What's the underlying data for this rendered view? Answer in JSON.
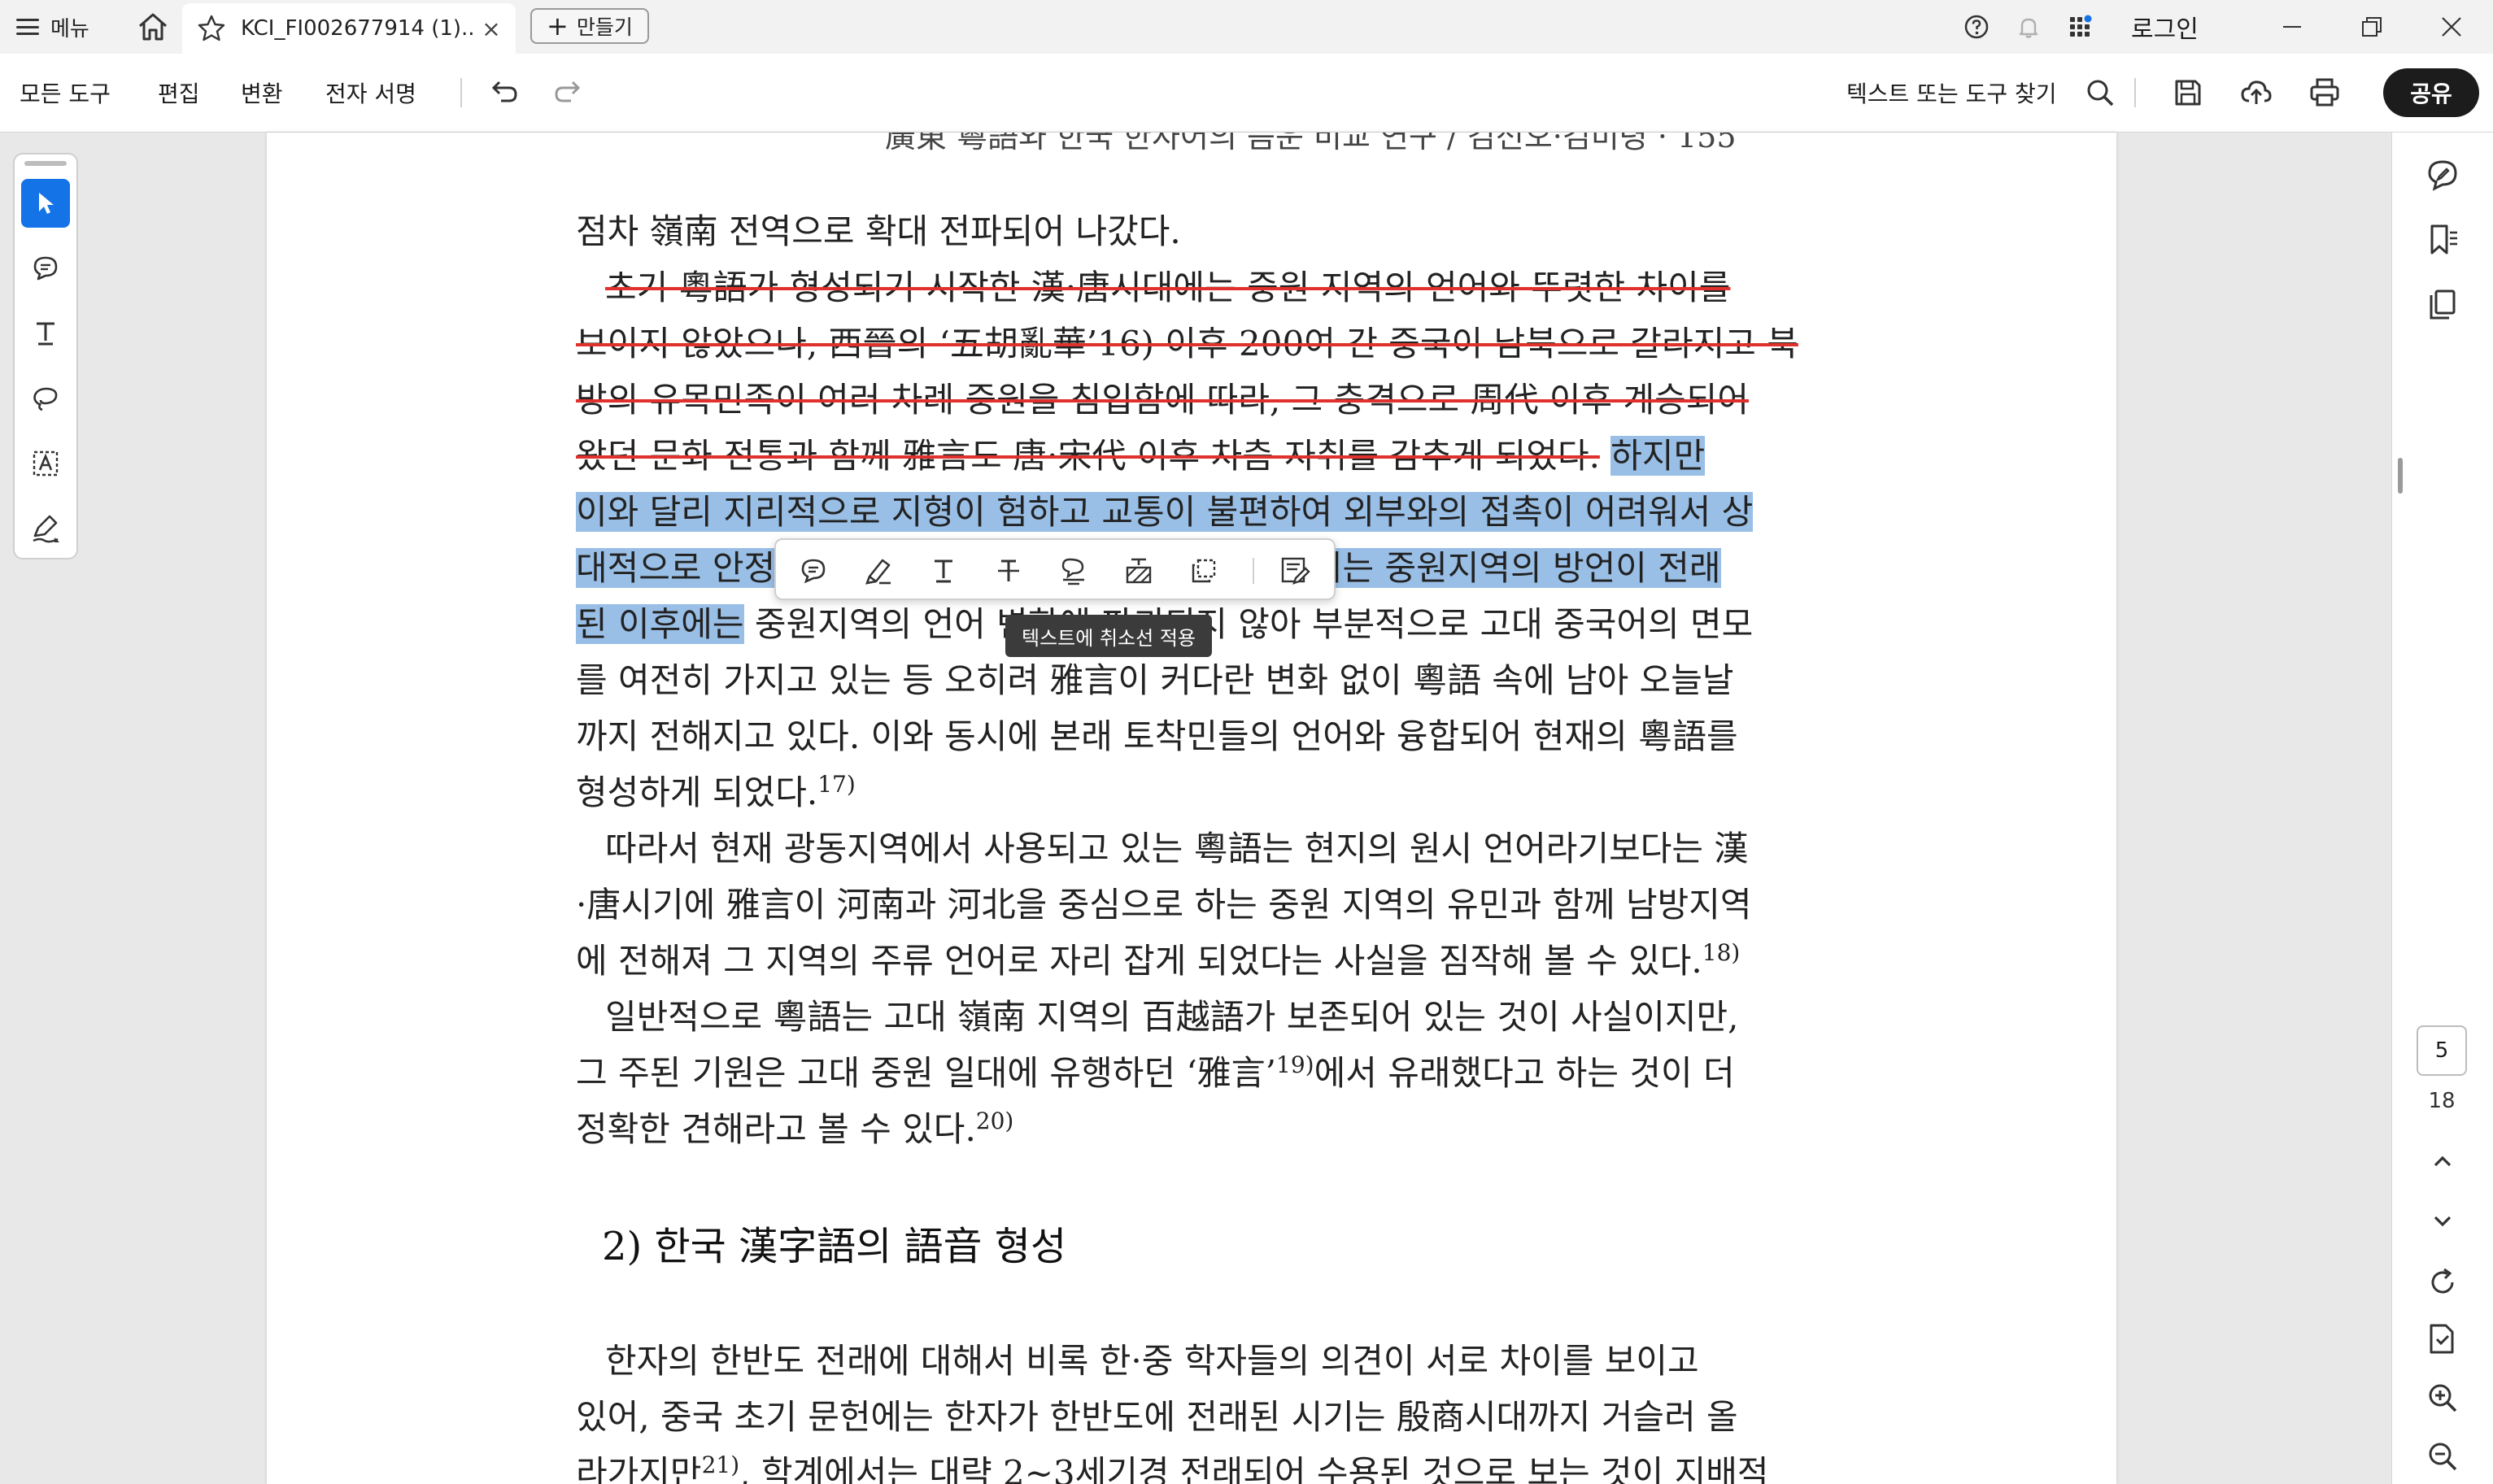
{
  "titlebar": {
    "menu_label": "메뉴",
    "tab_title": "KCI_FI002677914 (1)....",
    "tab_close": "×",
    "new_label": "만들기",
    "login_label": "로그인"
  },
  "toolbar": {
    "menus": [
      "모든 도구",
      "편집",
      "변환",
      "전자 서명"
    ],
    "find_label": "텍스트 또는 도구 찾기",
    "share_label": "공유"
  },
  "document": {
    "running_head": "廣東 粵語와 한국 한자어의 음운 비교 연구 / 김선오·김미령 · 155",
    "lines": [
      {
        "text": "점차 嶺南 전역으로 확대 전파되어 나갔다."
      },
      {
        "strike": "초기 粵語가 형성되기 시작한 漢·唐시대에는 중원 지역의 언어와 뚜렷한 차이를"
      },
      {
        "strike": "보이지 않았으나, 西晉의 ‘五胡亂華’16) 이후 200여 간 중국이 남북으로 갈라지고 북"
      },
      {
        "strike": "방의 유목민족이 여러 차례 중원을 침입함에 따라, 그 충격으로 周代 이후 계승되어"
      },
      {
        "strike": "왔던 문화 전통과 함께 雅言도 唐·宋代 이후 차츰 자취를 감추게 되었다.",
        "highlight": "하지만"
      },
      {
        "highlight": "이와 달리 지리적으로 지형이 험하고 교통이 불편하여 외부와의 접촉이 어려워서 상"
      },
      {
        "highlight": "대적으로 안정",
        "highlight_end": "에서는 중원지역의 방언이 전래"
      },
      {
        "highlight": "된 이후에는",
        "text": " 중원지역의 언어 변화에 파괴되지 않아 부분적으로 고대 중국어의 면모"
      },
      {
        "text": "를 여전히 가지고 있는 등 오히려 雅言이 커다란 변화 없이 粵語 속에 남아 오늘날"
      },
      {
        "text": "까지 전해지고 있다. 이와 동시에 본래 토착민들의 언어와 융합되어 현재의 粵語를"
      },
      {
        "text": "형성하게 되었다.",
        "sup": "17)"
      },
      {
        "text": "따라서 현재 광동지역에서 사용되고 있는 粵語는 현지의 원시 언어라기보다는 漢"
      },
      {
        "text": "·唐시기에 雅言이 河南과 河北을 중심으로 하는 중원 지역의 유민과 함께 남방지역"
      },
      {
        "text": "에 전해져 그 지역의 주류 언어로 자리 잡게 되었다는 사실을 짐작해 볼 수 있다.",
        "sup": "18)"
      },
      {
        "text": "일반적으로 粵語는 고대 嶺南 지역의 百越語가 보존되어 있는 것이 사실이지만,"
      },
      {
        "text": "그 주된 기원은 고대 중원 일대에 유행하던 ‘雅言’",
        "sup": "19)",
        "text2": "에서 유래했다고 하는 것이 더"
      },
      {
        "text": "정확한 견해라고 볼 수 있다.",
        "sup": "20)"
      }
    ],
    "heading": "2) 한국 漢字語의 語音 형성",
    "lines2": [
      {
        "text": "한자의 한반도 전래에 대해서 비록 한·중 학자들의 의견이 서로 차이를 보이고"
      },
      {
        "text": "있어, 중국 초기 문헌에는 한자가 한반도에 전래된 시기는 殷商시대까지 거슬러 올"
      },
      {
        "text": "라가지만",
        "sup": "21)",
        "text2": ", 학계에서는 대략 2~3세기경 전래되어 수용된 것으로 보는 것이 지배적"
      }
    ]
  },
  "quickbar": {
    "tooltip": "텍스트에 취소선 적용",
    "buttons": [
      "comment-icon",
      "highlight-icon",
      "text-icon",
      "strikethrough-icon",
      "underline-comment-icon",
      "redact-icon",
      "copy-icon",
      "edit-text-icon"
    ]
  },
  "rightrail": {
    "current_page": "5",
    "total_pages": "18"
  },
  "colors": {
    "accent": "#1473e6",
    "highlight": "#99bfe6",
    "strike": "#e0312d",
    "share_bg": "#1c1c1c"
  }
}
